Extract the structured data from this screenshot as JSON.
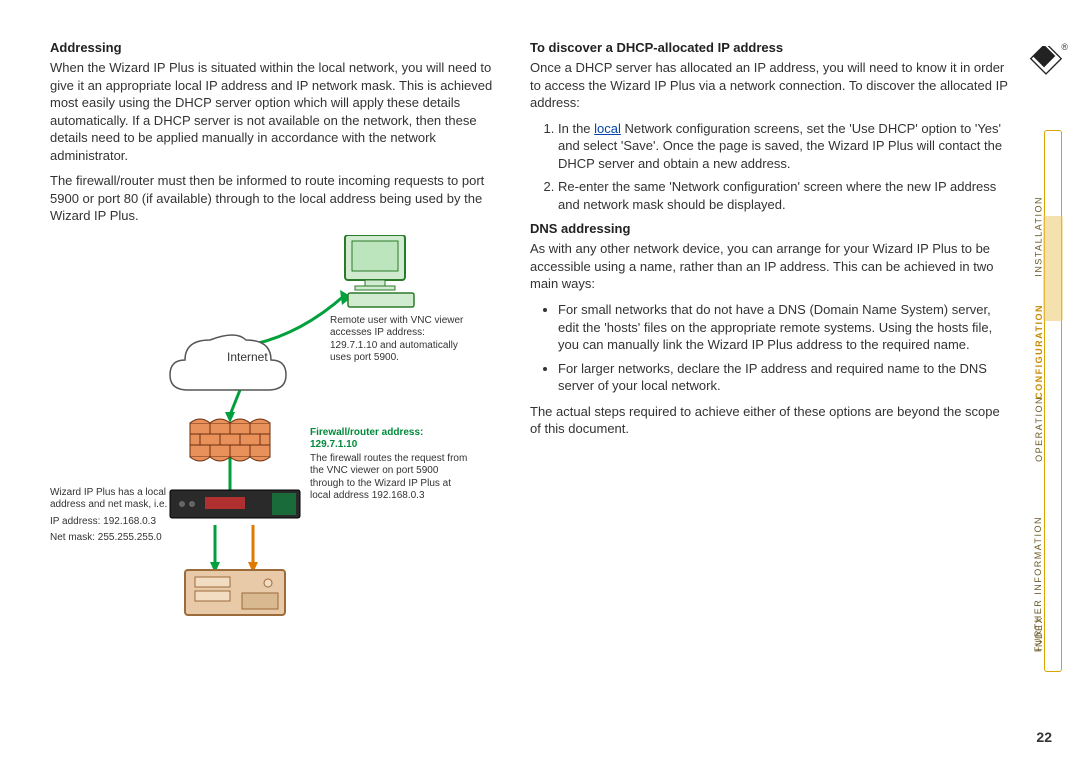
{
  "left": {
    "heading_addressing": "Addressing",
    "addressing_p1": "When the Wizard IP Plus is situated within the local network, you will need to give it an appropriate local IP address and IP network mask. This is achieved most easily using the DHCP server option which will apply these details automatically. If a DHCP server is not available on the network, then these details need to be applied manually in accordance with the network administrator.",
    "addressing_p2": "The firewall/router must then be informed to route incoming requests to port 5900 or port 80 (if available) through to the local address being used by the Wizard IP Plus.",
    "diagram": {
      "internet_label": "Internet",
      "remote_note": "Remote user with VNC viewer accesses IP address: 129.7.1.10 and automatically uses port 5900.",
      "firewall_title": "Firewall/router address: 129.7.1.10",
      "firewall_note": "The firewall routes the request from the VNC viewer on port 5900 through to the Wizard IP Plus at local address 192.168.0.3",
      "wizard_note_l1": "Wizard IP Plus has a local address and net mask, i.e.",
      "wizard_note_l2": "IP address: 192.168.0.3",
      "wizard_note_l3": "Net mask: 255.255.255.0"
    }
  },
  "right": {
    "heading_discover": "To discover a DHCP-allocated IP address",
    "discover_p1": "Once a DHCP server has allocated an IP address, you will need to know it in order to access the Wizard IP Plus via a network connection. To discover the allocated IP address:",
    "discover_li1_pre": "In the ",
    "discover_li1_link": "local",
    "discover_li1_post": " Network configuration screens, set the 'Use DHCP' option to 'Yes' and select 'Save'. Once the page is saved, the Wizard IP Plus will contact the DHCP server and obtain a new address.",
    "discover_li2": "Re-enter the same 'Network configuration' screen where the new IP address and network mask should be displayed.",
    "heading_dns": "DNS addressing",
    "dns_p1": "As with any other network device, you can arrange for your Wizard IP Plus to be accessible using a name, rather than an IP address. This can be achieved in two main ways:",
    "dns_li1": "For small networks that do not have a DNS (Domain Name System) server, edit the 'hosts' files on the appropriate remote systems. Using the hosts file, you can manually link the Wizard IP Plus address to the required name.",
    "dns_li2": "For larger networks, declare the IP address and required name to the DNS server of your local network.",
    "dns_p2": "The actual steps required to achieve either of these options are beyond the scope of this document."
  },
  "sidenav": {
    "installation": "INSTALLATION",
    "configuration": "CONFIGURATION",
    "operation": "OPERATION",
    "further": "FURTHER INFORMATION",
    "index": "INDEX"
  },
  "page_number": "22",
  "logo_trademark": "®"
}
